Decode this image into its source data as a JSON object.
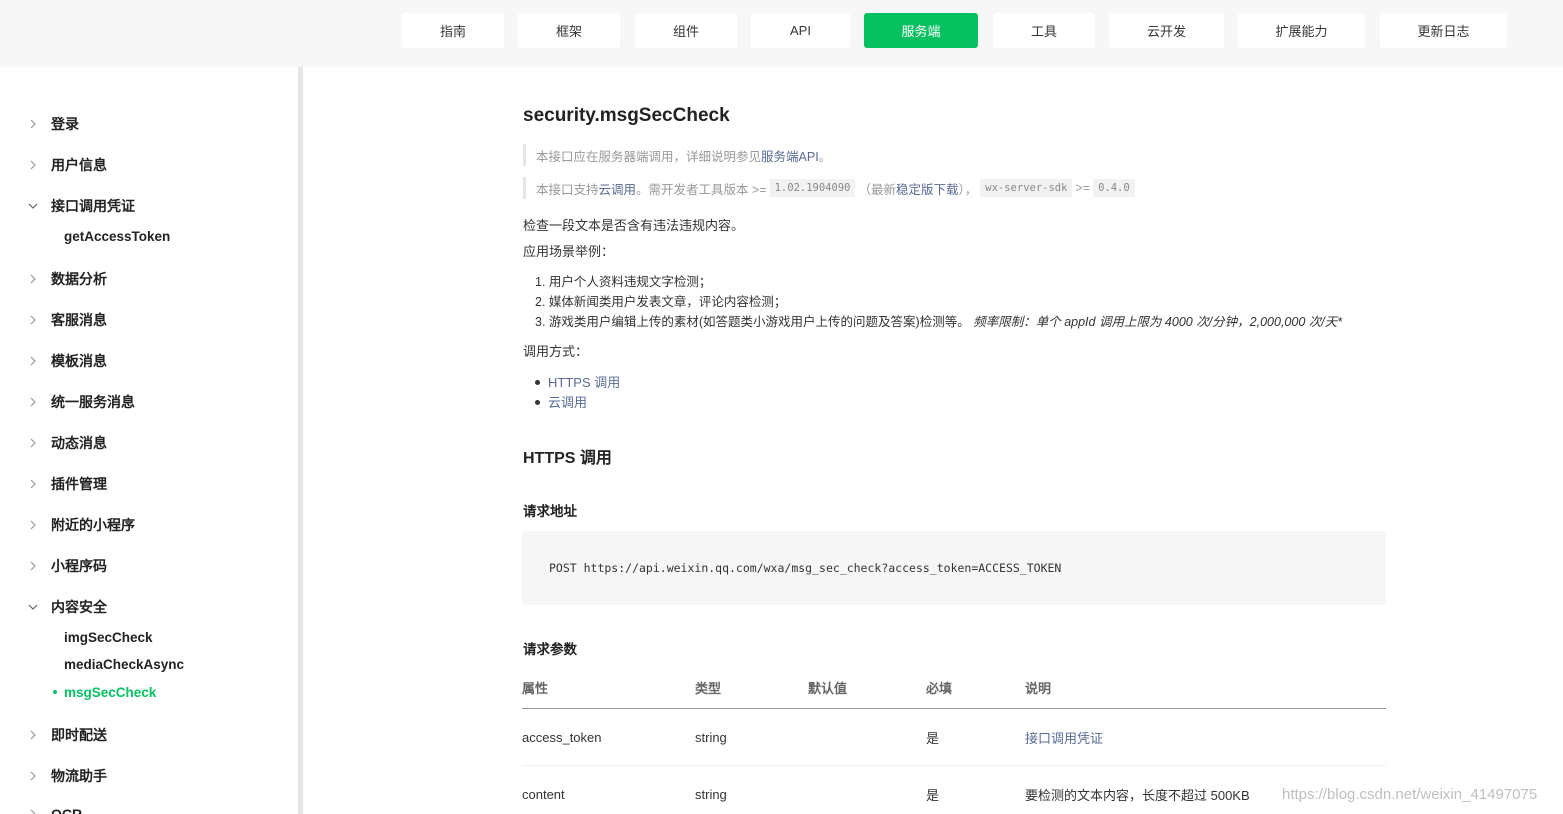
{
  "nav": {
    "items": [
      {
        "label": "指南"
      },
      {
        "label": "框架"
      },
      {
        "label": "组件"
      },
      {
        "label": "API"
      },
      {
        "label": "服务端"
      },
      {
        "label": "工具"
      },
      {
        "label": "云开发"
      },
      {
        "label": "扩展能力"
      },
      {
        "label": "更新日志"
      }
    ],
    "active": "服务端",
    "accent_color": "#07c160"
  },
  "sidebar": {
    "items": [
      {
        "label": "登录",
        "expanded": false
      },
      {
        "label": "用户信息",
        "expanded": false
      },
      {
        "label": "接口调用凭证",
        "expanded": true,
        "children": [
          "getAccessToken"
        ]
      },
      {
        "label": "数据分析",
        "expanded": false
      },
      {
        "label": "客服消息",
        "expanded": false
      },
      {
        "label": "模板消息",
        "expanded": false
      },
      {
        "label": "统一服务消息",
        "expanded": false
      },
      {
        "label": "动态消息",
        "expanded": false
      },
      {
        "label": "插件管理",
        "expanded": false
      },
      {
        "label": "附近的小程序",
        "expanded": false
      },
      {
        "label": "小程序码",
        "expanded": false
      },
      {
        "label": "内容安全",
        "expanded": true,
        "children": [
          "imgSecCheck",
          "mediaCheckAsync",
          "msgSecCheck"
        ]
      },
      {
        "label": "即时配送",
        "expanded": false
      },
      {
        "label": "物流助手",
        "expanded": false
      },
      {
        "label": "OCR",
        "expanded": false
      }
    ],
    "active_child": "msgSecCheck"
  },
  "doc": {
    "title": "security.msgSecCheck",
    "note1": {
      "text": "本接口应在服务器端调用，详细说明参见",
      "link": "服务端API",
      "end": "。"
    },
    "note2": {
      "t1": "本接口支持",
      "link1": "云调用",
      "t2": "。需开发者工具版本 >= ",
      "code1": "1.02.1904090",
      "t3": "（最新",
      "link2": "稳定版下载",
      "t4": "），",
      "code2": "wx-server-sdk",
      "t5": " >= ",
      "code3": "0.4.0"
    },
    "desc": "检查一段文本是否含有违法违规内容。",
    "scenarios_label": "应用场景举例：",
    "scenarios": [
      "1. 用户个人资料违规文字检测；",
      "2. 媒体新闻类用户发表文章，评论内容检测；",
      "3. 游戏类用户编辑上传的素材(如答题类小游戏用户上传的问题及答案)检测等。"
    ],
    "rate_limit": "频率限制：单个 appId 调用上限为 4000 次/分钟，2,000,000 次/天*",
    "call_methods_label": "调用方式：",
    "call_methods": [
      "HTTPS 调用",
      "云调用"
    ],
    "https_heading": "HTTPS 调用",
    "request_url_heading": "请求地址",
    "request_url": "POST https://api.weixin.qq.com/wxa/msg_sec_check?access_token=ACCESS_TOKEN",
    "params_heading": "请求参数",
    "params_table": {
      "headers": [
        "属性",
        "类型",
        "默认值",
        "必填",
        "说明"
      ],
      "rows": [
        {
          "name": "access_token",
          "type": "string",
          "default": "",
          "required": "是",
          "desc": "接口调用凭证",
          "desc_is_link": true
        },
        {
          "name": "content",
          "type": "string",
          "default": "",
          "required": "是",
          "desc": "要检测的文本内容，长度不超过 500KB",
          "desc_is_link": false
        }
      ]
    }
  },
  "watermark": "https://blog.csdn.net/weixin_41497075"
}
